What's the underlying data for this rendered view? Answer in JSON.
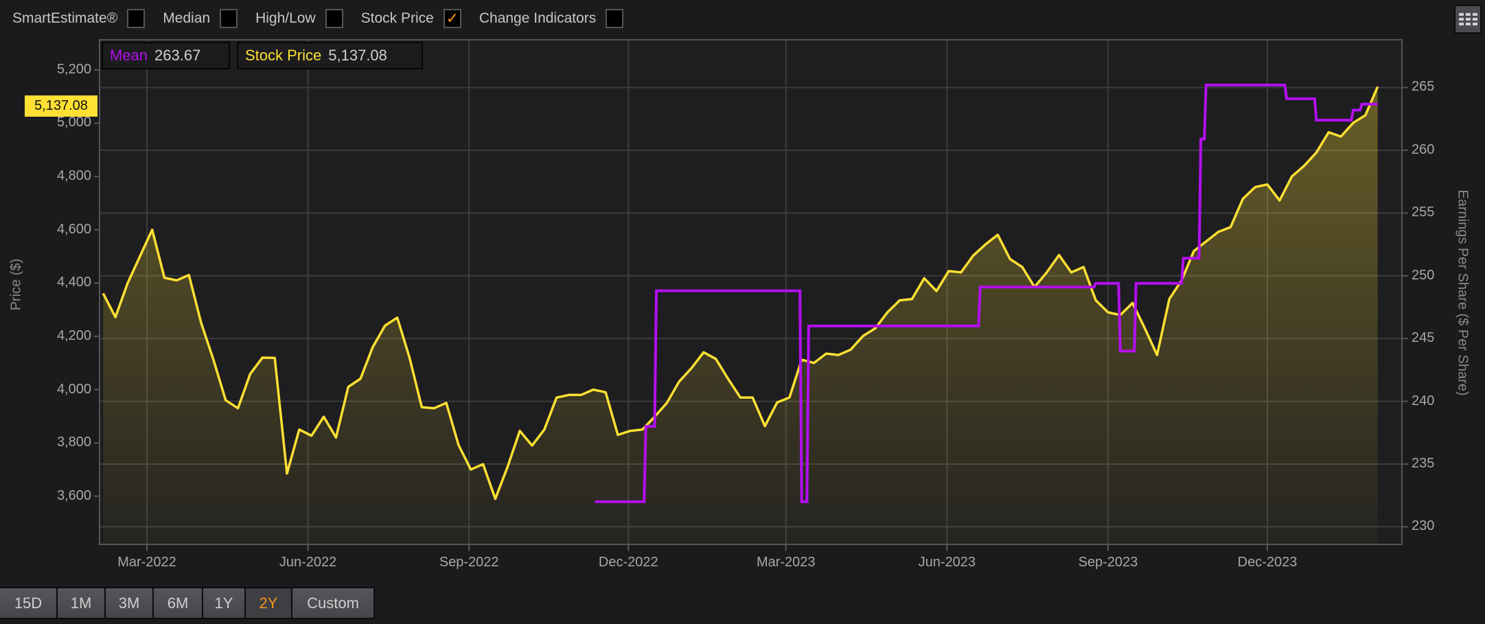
{
  "toolbar": {
    "options": [
      {
        "label": "SmartEstimate®",
        "checked": false
      },
      {
        "label": "Median",
        "checked": false
      },
      {
        "label": "High/Low",
        "checked": false
      },
      {
        "label": "Stock Price",
        "checked": true
      },
      {
        "label": "Change Indicators",
        "checked": false
      }
    ],
    "check_glyph": "✓",
    "grid_icon": "grid-menu-icon"
  },
  "legend": {
    "mean_label": "Mean",
    "mean_value": "263.67",
    "price_label": "Stock Price",
    "price_value": "5,137.08"
  },
  "price_badge": "5,137.08",
  "range_buttons": [
    {
      "label": "15D",
      "active": false
    },
    {
      "label": "1M",
      "active": false
    },
    {
      "label": "3M",
      "active": false
    },
    {
      "label": "6M",
      "active": false
    },
    {
      "label": "1Y",
      "active": false
    },
    {
      "label": "2Y",
      "active": true
    },
    {
      "label": "Custom",
      "active": false
    }
  ],
  "colors": {
    "price": "#ffe033",
    "mean": "#b30ff0",
    "active_range": "#f7931e"
  },
  "chart_data": {
    "type": "line",
    "grid": true,
    "x_axis": {
      "tick_labels": [
        "Mar-2022",
        "Jun-2022",
        "Sep-2022",
        "Dec-2022",
        "Mar-2023",
        "Jun-2023",
        "Sep-2023",
        "Dec-2023"
      ],
      "tick_dates": [
        "2022-03-01",
        "2022-06-01",
        "2022-09-01",
        "2022-12-01",
        "2023-03-01",
        "2023-06-01",
        "2023-09-01",
        "2023-12-01"
      ]
    },
    "y_left": {
      "label": "Price ($)",
      "range": [
        3419,
        5313
      ],
      "ticks": [
        5200,
        5000,
        4800,
        4600,
        4400,
        4200,
        4000,
        3800,
        3600
      ],
      "tick_labels": [
        "5,200",
        "5,000",
        "4,800",
        "4,600",
        "4,400",
        "4,200",
        "4,000",
        "3,800",
        "3,600"
      ]
    },
    "y_right": {
      "label": "Earnings Per Share ($ Per Share)",
      "range": [
        228.6,
        268.8
      ],
      "ticks": [
        265,
        260,
        255,
        250,
        245,
        240,
        235,
        230
      ],
      "tick_labels": [
        "265",
        "260",
        "255",
        "250",
        "245",
        "240",
        "235",
        "230"
      ]
    },
    "series": [
      {
        "name": "Stock Price",
        "axis": "left",
        "style": "area-line",
        "start": "2022-02-04",
        "step_days": 7,
        "values": [
          4361,
          4272,
          4400,
          4500,
          4600,
          4420,
          4410,
          4430,
          4250,
          4112,
          3960,
          3930,
          4059,
          4120,
          4119,
          3685,
          3850,
          3827,
          3898,
          3820,
          4010,
          4041,
          4160,
          4240,
          4270,
          4120,
          3934,
          3930,
          3950,
          3792,
          3700,
          3720,
          3590,
          3710,
          3845,
          3790,
          3850,
          3970,
          3980,
          3980,
          4000,
          3990,
          3830,
          3845,
          3850,
          3898,
          3950,
          4030,
          4080,
          4140,
          4115,
          4040,
          3970,
          3970,
          3863,
          3952,
          3970,
          4112,
          4100,
          4135,
          4130,
          4150,
          4201,
          4230,
          4290,
          4335,
          4340,
          4418,
          4370,
          4445,
          4440,
          4503,
          4545,
          4581,
          4490,
          4460,
          4385,
          4440,
          4505,
          4440,
          4460,
          4335,
          4290,
          4280,
          4325,
          4230,
          4130,
          4340,
          4410,
          4520,
          4556,
          4592,
          4610,
          4716,
          4760,
          4770,
          4710,
          4800,
          4840,
          4890,
          4966,
          4950,
          5001,
          5030,
          5137.08
        ]
      },
      {
        "name": "Mean",
        "axis": "right",
        "style": "step",
        "points": [
          [
            "2022-11-12",
            232.0
          ],
          [
            "2022-12-10",
            232.0
          ],
          [
            "2022-12-11",
            238.0
          ],
          [
            "2022-12-16",
            238.0
          ],
          [
            "2022-12-17",
            248.8
          ],
          [
            "2023-03-09",
            248.8
          ],
          [
            "2023-03-10",
            232.0
          ],
          [
            "2023-03-13",
            232.0
          ],
          [
            "2023-03-14",
            246.0
          ],
          [
            "2023-06-19",
            246.0
          ],
          [
            "2023-06-20",
            249.1
          ],
          [
            "2023-08-24",
            249.1
          ],
          [
            "2023-08-25",
            249.4
          ],
          [
            "2023-09-07",
            249.4
          ],
          [
            "2023-09-08",
            244.0
          ],
          [
            "2023-09-16",
            244.0
          ],
          [
            "2023-09-17",
            249.4
          ],
          [
            "2023-10-13",
            249.4
          ],
          [
            "2023-10-14",
            251.4
          ],
          [
            "2023-10-23",
            251.4
          ],
          [
            "2023-10-24",
            260.9
          ],
          [
            "2023-10-26",
            260.9
          ],
          [
            "2023-10-27",
            265.2
          ],
          [
            "2023-12-11",
            265.2
          ],
          [
            "2023-12-12",
            264.1
          ],
          [
            "2023-12-28",
            264.1
          ],
          [
            "2023-12-29",
            262.4
          ],
          [
            "2024-01-18",
            262.4
          ],
          [
            "2024-01-19",
            263.2
          ],
          [
            "2024-01-23",
            263.2
          ],
          [
            "2024-01-24",
            263.67
          ],
          [
            "2024-02-02",
            263.67
          ]
        ]
      }
    ]
  }
}
